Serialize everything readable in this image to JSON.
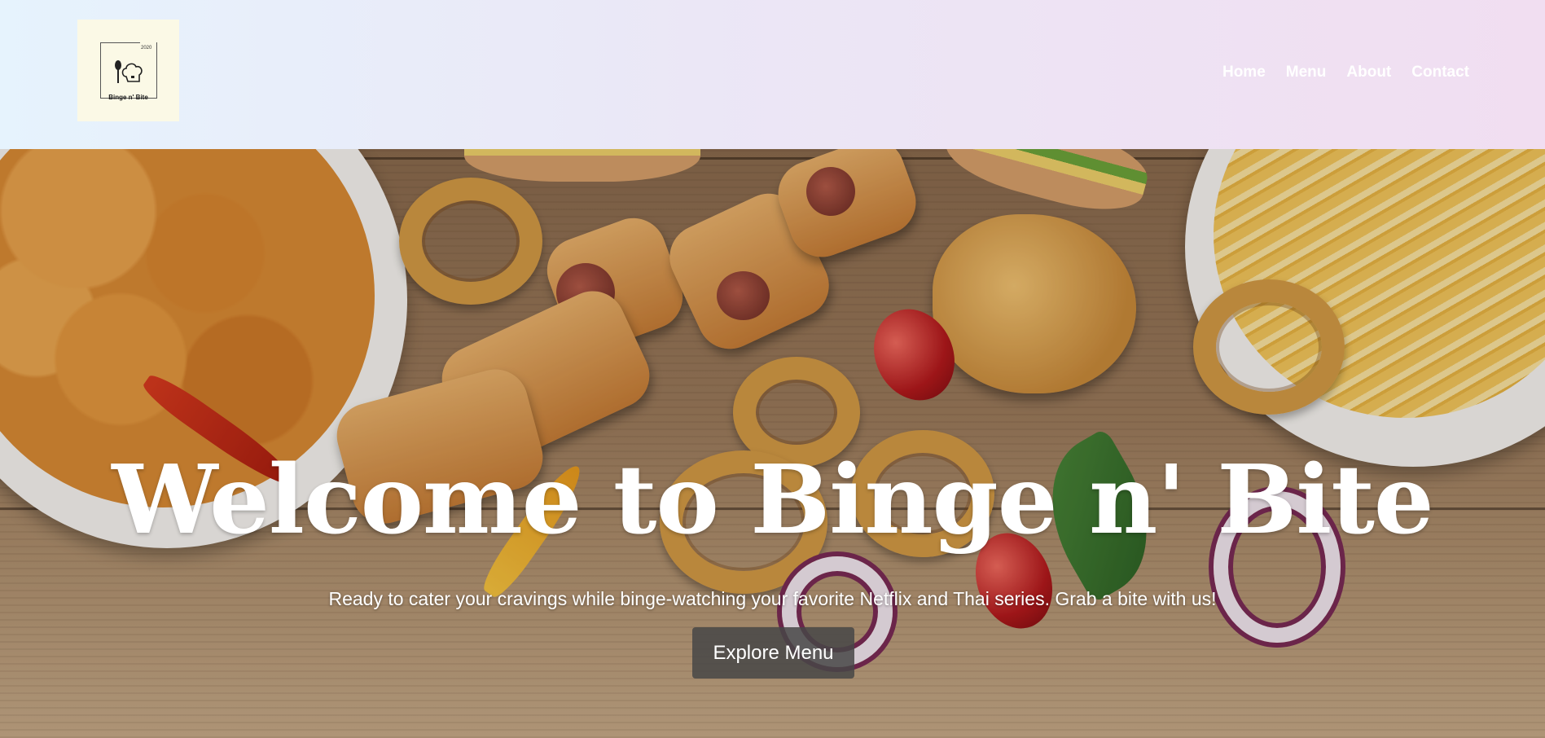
{
  "brand": {
    "logo_year": "2020",
    "logo_name": "Binge n' Bite"
  },
  "nav": {
    "items": [
      {
        "label": "Home"
      },
      {
        "label": "Menu"
      },
      {
        "label": "About"
      },
      {
        "label": "Contact"
      }
    ]
  },
  "hero": {
    "title": "Welcome to Binge n' Bite",
    "subtitle": "Ready to cater your cravings while binge-watching your favorite Netflix and Thai series. Grab a bite with us!",
    "cta_label": "Explore Menu"
  },
  "colors": {
    "header_gradient_start": "#e6f3fd",
    "header_gradient_end": "#f1def1",
    "logo_background": "#fbf9e6",
    "nav_text": "#ffffff",
    "cta_background": "#464646"
  }
}
